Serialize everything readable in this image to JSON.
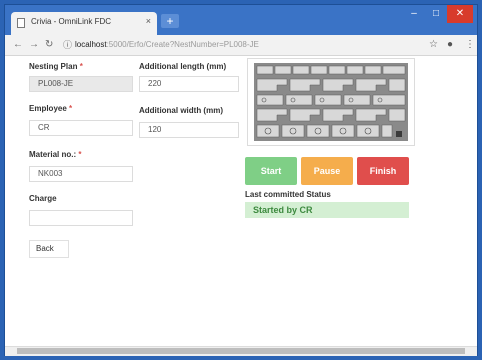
{
  "browser": {
    "tab_title": "Crivia - OmniLink FDC",
    "tab_close": "×",
    "new_tab": "+",
    "url_host": "localhost",
    "url_path": ":5000/Erfo/Create?NestNumber=PL008-JE",
    "win_minimize": "–",
    "win_maximize": "□",
    "win_close": "✕"
  },
  "form": {
    "nesting_plan": {
      "label": "Nesting Plan",
      "required": "*",
      "value": "PL008-JE"
    },
    "employee": {
      "label": "Employee",
      "required": "*",
      "value": "CR"
    },
    "material_no": {
      "label": "Material no.:",
      "required": "*",
      "value": "NK003"
    },
    "charge": {
      "label": "Charge",
      "value": ""
    },
    "additional_length": {
      "label": "Additional length (mm)",
      "value": "220"
    },
    "additional_width": {
      "label": "Additional width (mm)",
      "value": "120"
    },
    "back_label": "Back"
  },
  "actions": {
    "start": "Start",
    "pause": "Pause",
    "finish": "Finish"
  },
  "status": {
    "label": "Last committed Status",
    "value": "Started by CR",
    "color": "#3d8a3f"
  },
  "colors": {
    "start": "#7fcf86",
    "pause": "#f5ad4c",
    "finish": "#e04e4c",
    "titlebar": "#3a73c6"
  }
}
